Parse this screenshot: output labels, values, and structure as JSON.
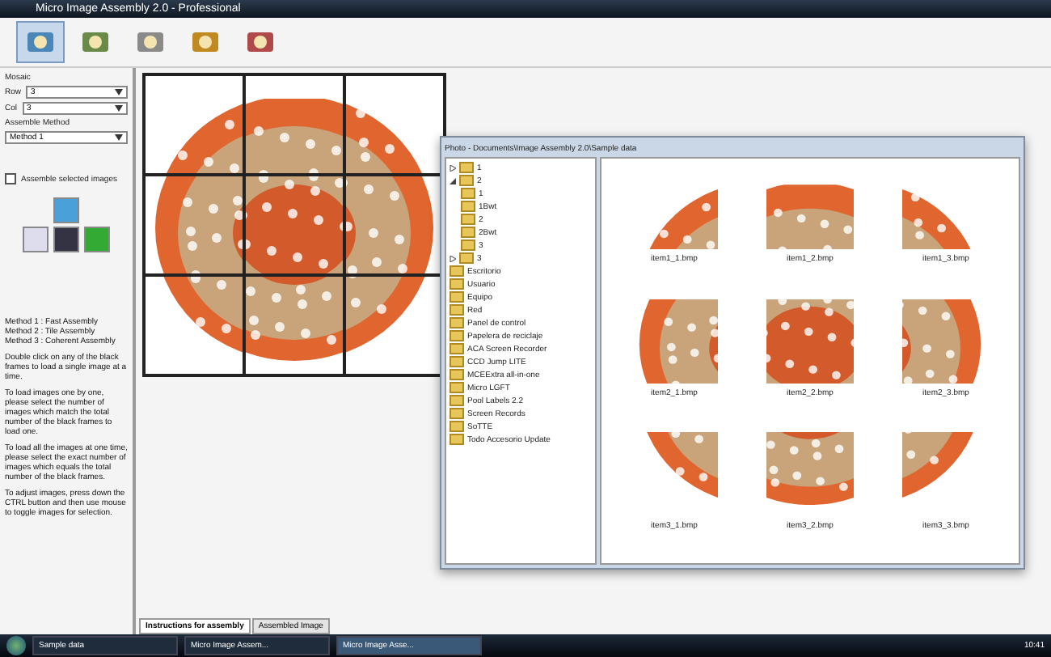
{
  "window": {
    "title": "Micro Image Assembly 2.0 - Professional"
  },
  "toolbar": {
    "buttons": [
      {
        "selected": true
      },
      {
        "selected": false
      },
      {
        "selected": false
      },
      {
        "selected": false
      },
      {
        "selected": false
      }
    ]
  },
  "settings": {
    "group_label": "Mosaic",
    "fields": [
      {
        "label": "Row",
        "value": "3"
      },
      {
        "label": "Col",
        "value": "3"
      }
    ],
    "method_label": "Assemble Method",
    "method_value": "Method 1",
    "assemble_selected": {
      "label": "Assemble selected images",
      "checked": false
    }
  },
  "instructions": [
    "Method 1 : Fast Assembly\nMethod 2 : Tile Assembly\nMethod 3 : Coherent Assembly",
    "Double click on any of the black frames to load a single image at a time.",
    "To load images one by one, please select the number of images which match the total number of the black frames to load one.",
    "To load all the images at one time, please select the exact number of images which equals the total number of the black frames.",
    "To adjust images, press down the CTRL button and then use mouse to toggle images for selection."
  ],
  "tabs": [
    {
      "label": "Instructions for assembly",
      "selected": true
    },
    {
      "label": "Assembled Image",
      "selected": false
    }
  ],
  "explorer": {
    "title": "Photo - Documents\\Image Assembly 2.0\\Sample data",
    "tree": [
      {
        "label": "1",
        "expanded": false
      },
      {
        "label": "2",
        "expanded": true,
        "children": [
          {
            "label": "1"
          },
          {
            "label": "1Bwt"
          },
          {
            "label": "2"
          },
          {
            "label": "2Bwt"
          },
          {
            "label": "3"
          }
        ]
      },
      {
        "label": "3",
        "expanded": false
      }
    ],
    "places": [
      "Escritorio",
      "Usuario",
      "Equipo",
      "Red",
      "Panel de control",
      "Papelera de reciclaje",
      "ACA Screen Recorder",
      "CCD Jump LITE",
      "MCEExtra all-in-one",
      "Micro LGFT",
      "Pool Labels 2.2",
      "Screen Records",
      "SoTTE",
      "Todo Accesorio Update"
    ],
    "files": [
      "item1_1.bmp",
      "item1_2.bmp",
      "item1_3.bmp",
      "item2_1.bmp",
      "item2_2.bmp",
      "item2_3.bmp",
      "item3_1.bmp",
      "item3_2.bmp",
      "item3_3.bmp"
    ]
  },
  "taskbar": {
    "tasks": [
      {
        "label": "Sample data",
        "selected": false
      },
      {
        "label": "Micro Image Assem...",
        "selected": false
      },
      {
        "label": "Micro Image Asse...",
        "selected": true
      }
    ],
    "time": "10:41"
  }
}
